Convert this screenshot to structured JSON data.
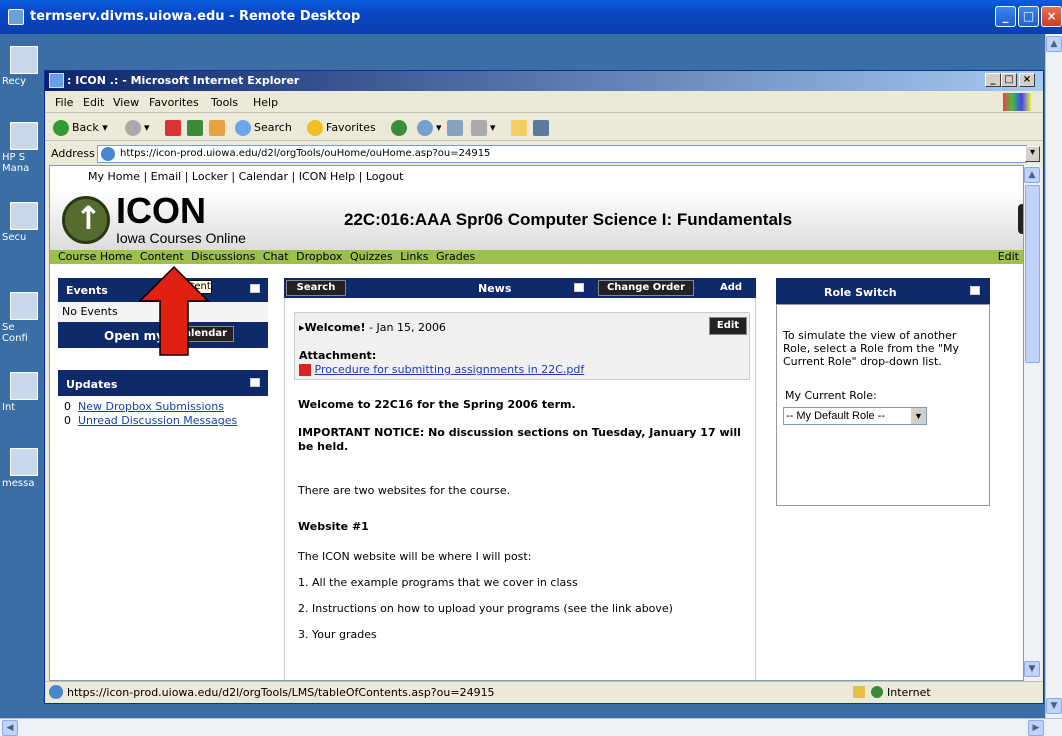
{
  "rd": {
    "title": "termserv.divms.uiowa.edu - Remote Desktop"
  },
  "desktop_icons": [
    {
      "label": "Recy",
      "top": 0
    },
    {
      "label": "HP S Mana",
      "top": 0
    },
    {
      "label": "Secu",
      "top": 0
    },
    {
      "label": "Se Confi",
      "top": 0
    },
    {
      "label": "Int",
      "top": 0
    },
    {
      "label": "messa",
      "top": 0
    }
  ],
  "ie": {
    "title": ": ICON .: - Microsoft Internet Explorer",
    "menu": [
      "File",
      "Edit",
      "View",
      "Favorites",
      "Tools",
      "Help"
    ],
    "toolbar": {
      "back": "Back",
      "search": "Search",
      "favorites": "Favorites"
    },
    "address_label": "Address",
    "address": "https://icon-prod.uiowa.edu/d2l/orgTools/ouHome/ouHome.asp?ou=24915",
    "status_url": "https://icon-prod.uiowa.edu/d2l/orgTools/LMS/tableOfContents.asp?ou=24915",
    "status_zone": "Internet"
  },
  "page": {
    "toplinks": "My Home | Email | Locker | Calendar | ICON Help | Logout",
    "logo": "ICON",
    "logo_sub": "Iowa Courses Online",
    "course_title": "22C:016:AAA Spr06 Computer Science I: Fundamentals",
    "nav": [
      "Course Home",
      "Content",
      "Discussions",
      "Chat",
      "Dropbox",
      "Quizzes",
      "Links",
      "Grades"
    ],
    "nav_edit": "Edit",
    "tooltip": "Content",
    "events": {
      "title": "Events",
      "empty": "No Events",
      "open": "Open my",
      "calendar_btn": "Calendar"
    },
    "updates": {
      "title": "Updates",
      "items": [
        {
          "count": "0",
          "label": "New Dropbox Submissions"
        },
        {
          "count": "0",
          "label": "Unread Discussion Messages"
        }
      ]
    },
    "news": {
      "search_btn": "Search",
      "title": "News",
      "order_btn": "Change Order",
      "add_btn": "Add",
      "item_title": "Welcome!",
      "item_date": "- Jan 15, 2006",
      "edit_btn": "Edit",
      "attachment_label": "Attachment:",
      "attachment": "Procedure for submitting assignments in 22C.pdf",
      "p1": "Welcome to 22C16 for the Spring 2006 term.",
      "p2": "IMPORTANT NOTICE: No discussion sections on Tuesday, January 17 will be held.",
      "p3": "There are two websites for the course.",
      "p4": "Website #1",
      "p5": "The ICON website will be where I will post:",
      "p6": "1. All the example programs that we cover in class",
      "p7": "2. Instructions on how to upload your programs (see the link above)",
      "p8": "3. Your grades"
    },
    "role": {
      "title": "Role Switch",
      "desc": "To simulate the view of another Role, select a Role from the \"My Current Role\" drop-down list.",
      "label": "My Current Role:",
      "value": "-- My Default Role --"
    }
  },
  "colors": {
    "widget_header": "#0f2a6b",
    "navbar": "#9dbf4c",
    "arrow": "#e02010"
  }
}
